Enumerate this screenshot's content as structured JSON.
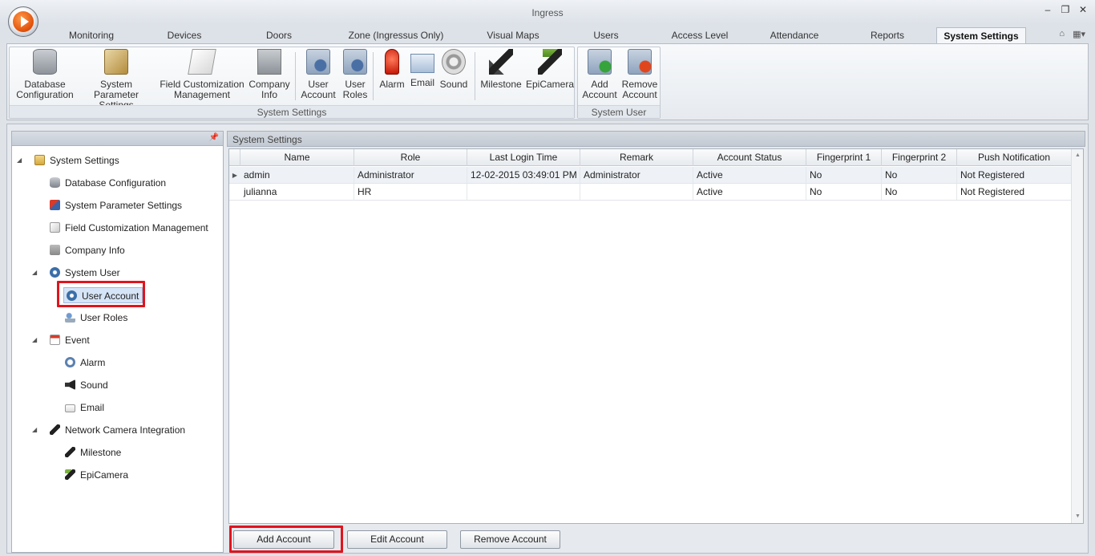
{
  "window": {
    "title": "Ingress"
  },
  "tabs": [
    "Monitoring",
    "Devices",
    "Doors",
    "Zone (Ingressus Only)",
    "Visual Maps",
    "Users",
    "Access Level",
    "Attendance",
    "Reports",
    "System Settings"
  ],
  "active_tab": "System Settings",
  "ribbon": {
    "groups": [
      {
        "label": "System Settings",
        "buttons": [
          {
            "line1": "Database",
            "line2": "Configuration",
            "icon": "database-icon"
          },
          {
            "line1": "System Parameter",
            "line2": "Settings",
            "icon": "tools-icon"
          },
          {
            "line1": "Field Customization",
            "line2": "Management",
            "icon": "field-customization-icon"
          },
          {
            "line1": "Company",
            "line2": "Info",
            "icon": "company-icon"
          },
          {
            "line1": "User",
            "line2": "Account",
            "icon": "user-account-icon"
          },
          {
            "line1": "User",
            "line2": "Roles",
            "icon": "user-roles-icon"
          },
          {
            "line1": "Alarm",
            "line2": "",
            "icon": "alarm-icon"
          },
          {
            "line1": "Email",
            "line2": "",
            "icon": "email-icon"
          },
          {
            "line1": "Sound",
            "line2": "",
            "icon": "sound-icon"
          },
          {
            "line1": "Milestone",
            "line2": "",
            "icon": "milestone-camera-icon"
          },
          {
            "line1": "EpiCamera",
            "line2": "",
            "icon": "epicamera-icon"
          }
        ]
      },
      {
        "label": "System User",
        "buttons": [
          {
            "line1": "Add",
            "line2": "Account",
            "icon": "add-account-icon"
          },
          {
            "line1": "Remove",
            "line2": "Account",
            "icon": "remove-account-icon"
          }
        ]
      }
    ]
  },
  "tree": [
    {
      "label": "System Settings",
      "icon": "folder-icon",
      "expander": "◢"
    },
    {
      "label": "Database Configuration",
      "icon": "database-icon"
    },
    {
      "label": "System Parameter Settings",
      "icon": "tools-icon"
    },
    {
      "label": "Field Customization Management",
      "icon": "field-customization-icon"
    },
    {
      "label": "Company Info",
      "icon": "company-icon"
    },
    {
      "label": "System User",
      "icon": "gear-icon",
      "expander": "◢"
    },
    {
      "label": "User Account",
      "icon": "gear-icon",
      "selected": true
    },
    {
      "label": "User Roles",
      "icon": "user-roles-icon"
    },
    {
      "label": "Event",
      "icon": "event-icon",
      "expander": "◢"
    },
    {
      "label": "Alarm",
      "icon": "clock-icon"
    },
    {
      "label": "Sound",
      "icon": "speaker-icon"
    },
    {
      "label": "Email",
      "icon": "mail-icon"
    },
    {
      "label": "Network Camera Integration",
      "icon": "camera-icon",
      "expander": "◢"
    },
    {
      "label": "Milestone",
      "icon": "milestone-camera-icon"
    },
    {
      "label": "EpiCamera",
      "icon": "epicamera-icon"
    }
  ],
  "grid": {
    "caption": "System Settings",
    "columns": [
      "Name",
      "Role",
      "Last Login Time",
      "Remark",
      "Account Status",
      "Fingerprint 1",
      "Fingerprint 2",
      "Push Notification"
    ],
    "rows": [
      [
        "admin",
        "Administrator",
        "12-02-2015 03:49:01 PM",
        "Administrator",
        "Active",
        "No",
        "No",
        "Not Registered"
      ],
      [
        "julianna",
        "HR",
        "",
        "",
        "Active",
        "No",
        "No",
        "Not Registered"
      ]
    ]
  },
  "actions": {
    "add": "Add Account",
    "edit": "Edit Account",
    "remove": "Remove Account"
  },
  "colors": {
    "highlight": "#e0141e",
    "accent": "#e0500a"
  }
}
